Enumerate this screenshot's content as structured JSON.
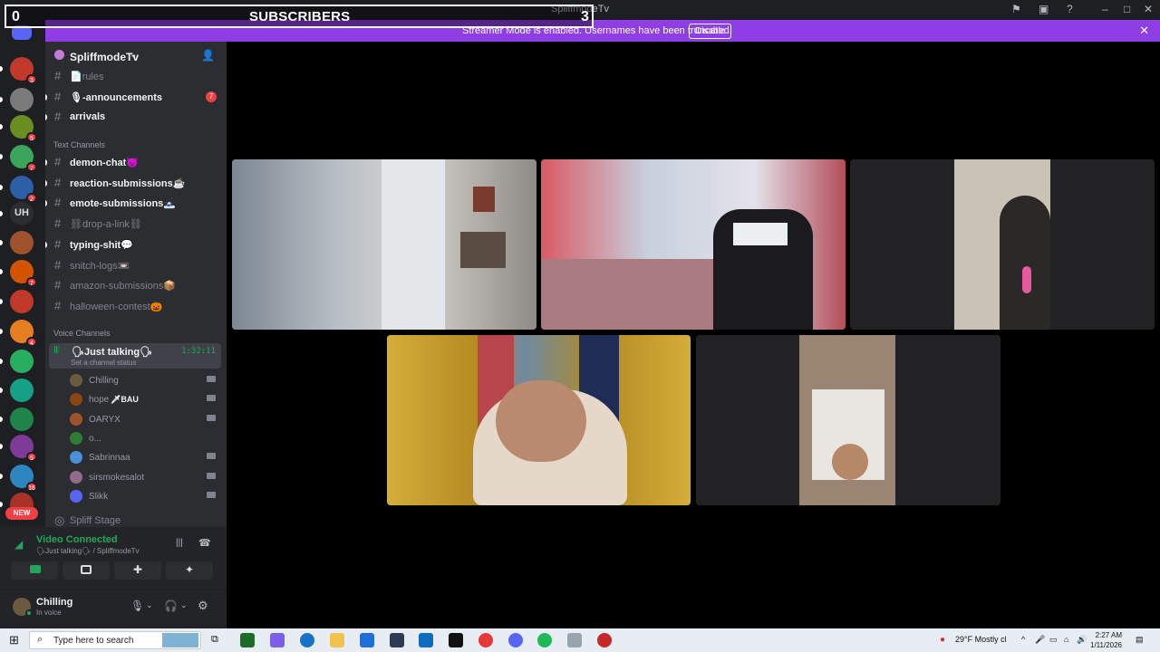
{
  "window": {
    "title": "SpliffmodeTv"
  },
  "overlay": {
    "left_count": "0",
    "label": "SUBSCRIBERS",
    "right_count": "3"
  },
  "banner": {
    "message": "Streamer Mode is enabled. Usernames have been truncated.",
    "disable_label": "Disable"
  },
  "servers": [
    {
      "color": "#c0392b",
      "badge": "3"
    },
    {
      "color": "#7a7a7a",
      "badge": ""
    },
    {
      "color": "#6b8e23",
      "badge": "5"
    },
    {
      "color": "#3ba55c",
      "badge": "7"
    },
    {
      "color": "#2c5fa8",
      "badge": "2"
    },
    {
      "color": "#2b2d31",
      "badge": "",
      "initials": "UH"
    },
    {
      "color": "#a0522d",
      "badge": ""
    },
    {
      "color": "#d35400",
      "badge": "7"
    },
    {
      "color": "#c0392b",
      "badge": ""
    },
    {
      "color": "#e67e22",
      "badge": "4"
    },
    {
      "color": "#27ae60",
      "badge": ""
    },
    {
      "color": "#16a085",
      "badge": ""
    },
    {
      "color": "#1e8449",
      "badge": ""
    },
    {
      "color": "#7d3c98",
      "badge": "5"
    },
    {
      "color": "#2e86c1",
      "badge": "16"
    },
    {
      "color": "#a93226",
      "badge": ""
    }
  ],
  "rail_new_badge": "NEW",
  "server": {
    "name": "SpliffmodeTv"
  },
  "channels_top": [
    {
      "label": "📄rules",
      "unread": false,
      "ping": ""
    },
    {
      "label": "🎙-announcements",
      "unread": true,
      "ping": "7"
    },
    {
      "label": "arrivals",
      "unread": true,
      "ping": ""
    }
  ],
  "text_category": "Text Channels",
  "text_channels": [
    {
      "label": "demon-chat😈",
      "unread": true
    },
    {
      "label": "reaction-submissions☕",
      "unread": true
    },
    {
      "label": "emote-submissions🗻",
      "unread": true
    },
    {
      "label": "⛓drop-a-link⛓",
      "unread": false
    },
    {
      "label": "typing-shit💬",
      "unread": true
    },
    {
      "label": "snitch-logs📼",
      "unread": false
    },
    {
      "label": "amazon-submissions📦",
      "unread": false
    },
    {
      "label": "halloween-contest🎃",
      "unread": false
    }
  ],
  "voice_category": "Voice Channels",
  "voice_channel": {
    "label": "🗣Just talking🗣",
    "time": "1:32:11",
    "status": "Set a channel status"
  },
  "members": [
    {
      "name": "Chilling",
      "color": "#6b5b3e"
    },
    {
      "name": "hope",
      "tag": "🗡BAU",
      "color": "#8b4513"
    },
    {
      "name": "OARYX",
      "color": "#a0522d"
    },
    {
      "name": "o...",
      "color": "#2e7d32"
    },
    {
      "name": "Sabrinnaa",
      "color": "#4a90d9"
    },
    {
      "name": "sirsmokesalot",
      "color": "#8e6c8a"
    },
    {
      "name": "Slikk",
      "color": "#5865f2"
    }
  ],
  "stage_channel": "Spliff Stage",
  "voice_panel": {
    "status": "Video Connected",
    "location": "🗣Just talking🗣 / SpliffmodeTv"
  },
  "user": {
    "name": "Chilling",
    "status": "In voice"
  },
  "taskbar": {
    "search_placeholder": "Type here to search",
    "weather": "29°F  Mostly cl",
    "time": "2:27 AM",
    "date": "1/11/2026"
  },
  "colors": {
    "banner": "#8f3ee6",
    "connected": "#23a55a",
    "ping": "#f23f43"
  }
}
